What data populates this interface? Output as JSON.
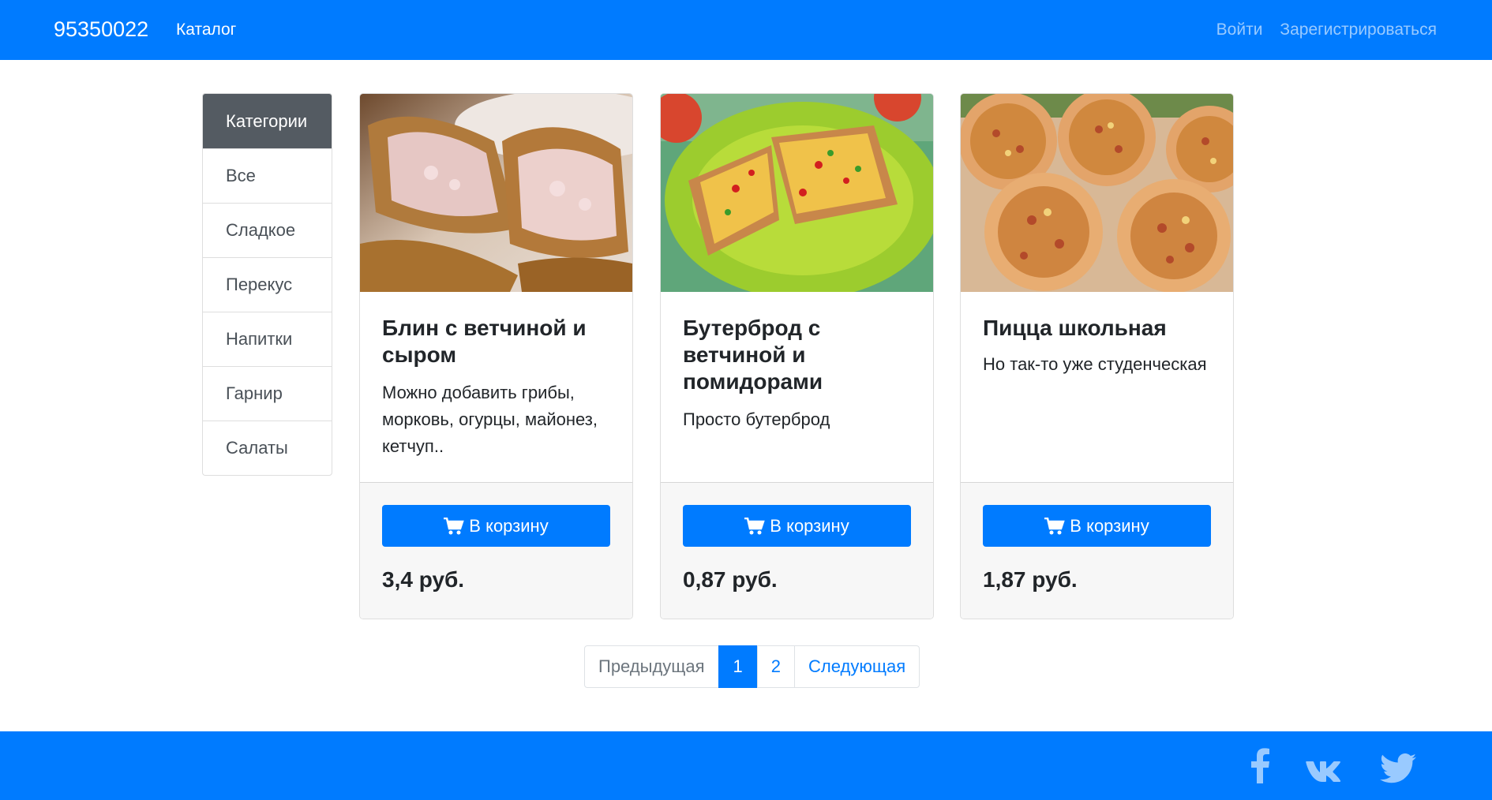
{
  "navbar": {
    "brand": "95350022",
    "catalog_link": "Каталог",
    "login_link": "Войти",
    "register_link": "Зарегистрироваться"
  },
  "sidebar": {
    "header": "Категории",
    "items": [
      {
        "label": "Все"
      },
      {
        "label": "Сладкое"
      },
      {
        "label": "Перекус"
      },
      {
        "label": "Напитки"
      },
      {
        "label": "Гарнир"
      },
      {
        "label": "Салаты"
      }
    ]
  },
  "products": [
    {
      "title": "Блин с ветчиной и сыром",
      "description": "Можно добавить грибы, морковь, огурцы, майонез, кетчуп..",
      "button": "В корзину",
      "price": "3,4 руб."
    },
    {
      "title": "Бутерброд с ветчиной и помидорами",
      "description": "Просто бутерброд",
      "button": "В корзину",
      "price": "0,87 руб."
    },
    {
      "title": "Пицца школьная",
      "description": "Но так-то уже студенческая",
      "button": "В корзину",
      "price": "1,87 руб."
    }
  ],
  "pagination": {
    "prev": "Предыдущая",
    "pages": [
      "1",
      "2"
    ],
    "active_page": "1",
    "next": "Следующая"
  },
  "footer": {
    "social_icons": [
      "facebook-icon",
      "vk-icon",
      "twitter-icon"
    ]
  },
  "colors": {
    "primary": "#007bff",
    "sidebar_header": "#545b62",
    "footer_bg": "#f7f7f7"
  }
}
